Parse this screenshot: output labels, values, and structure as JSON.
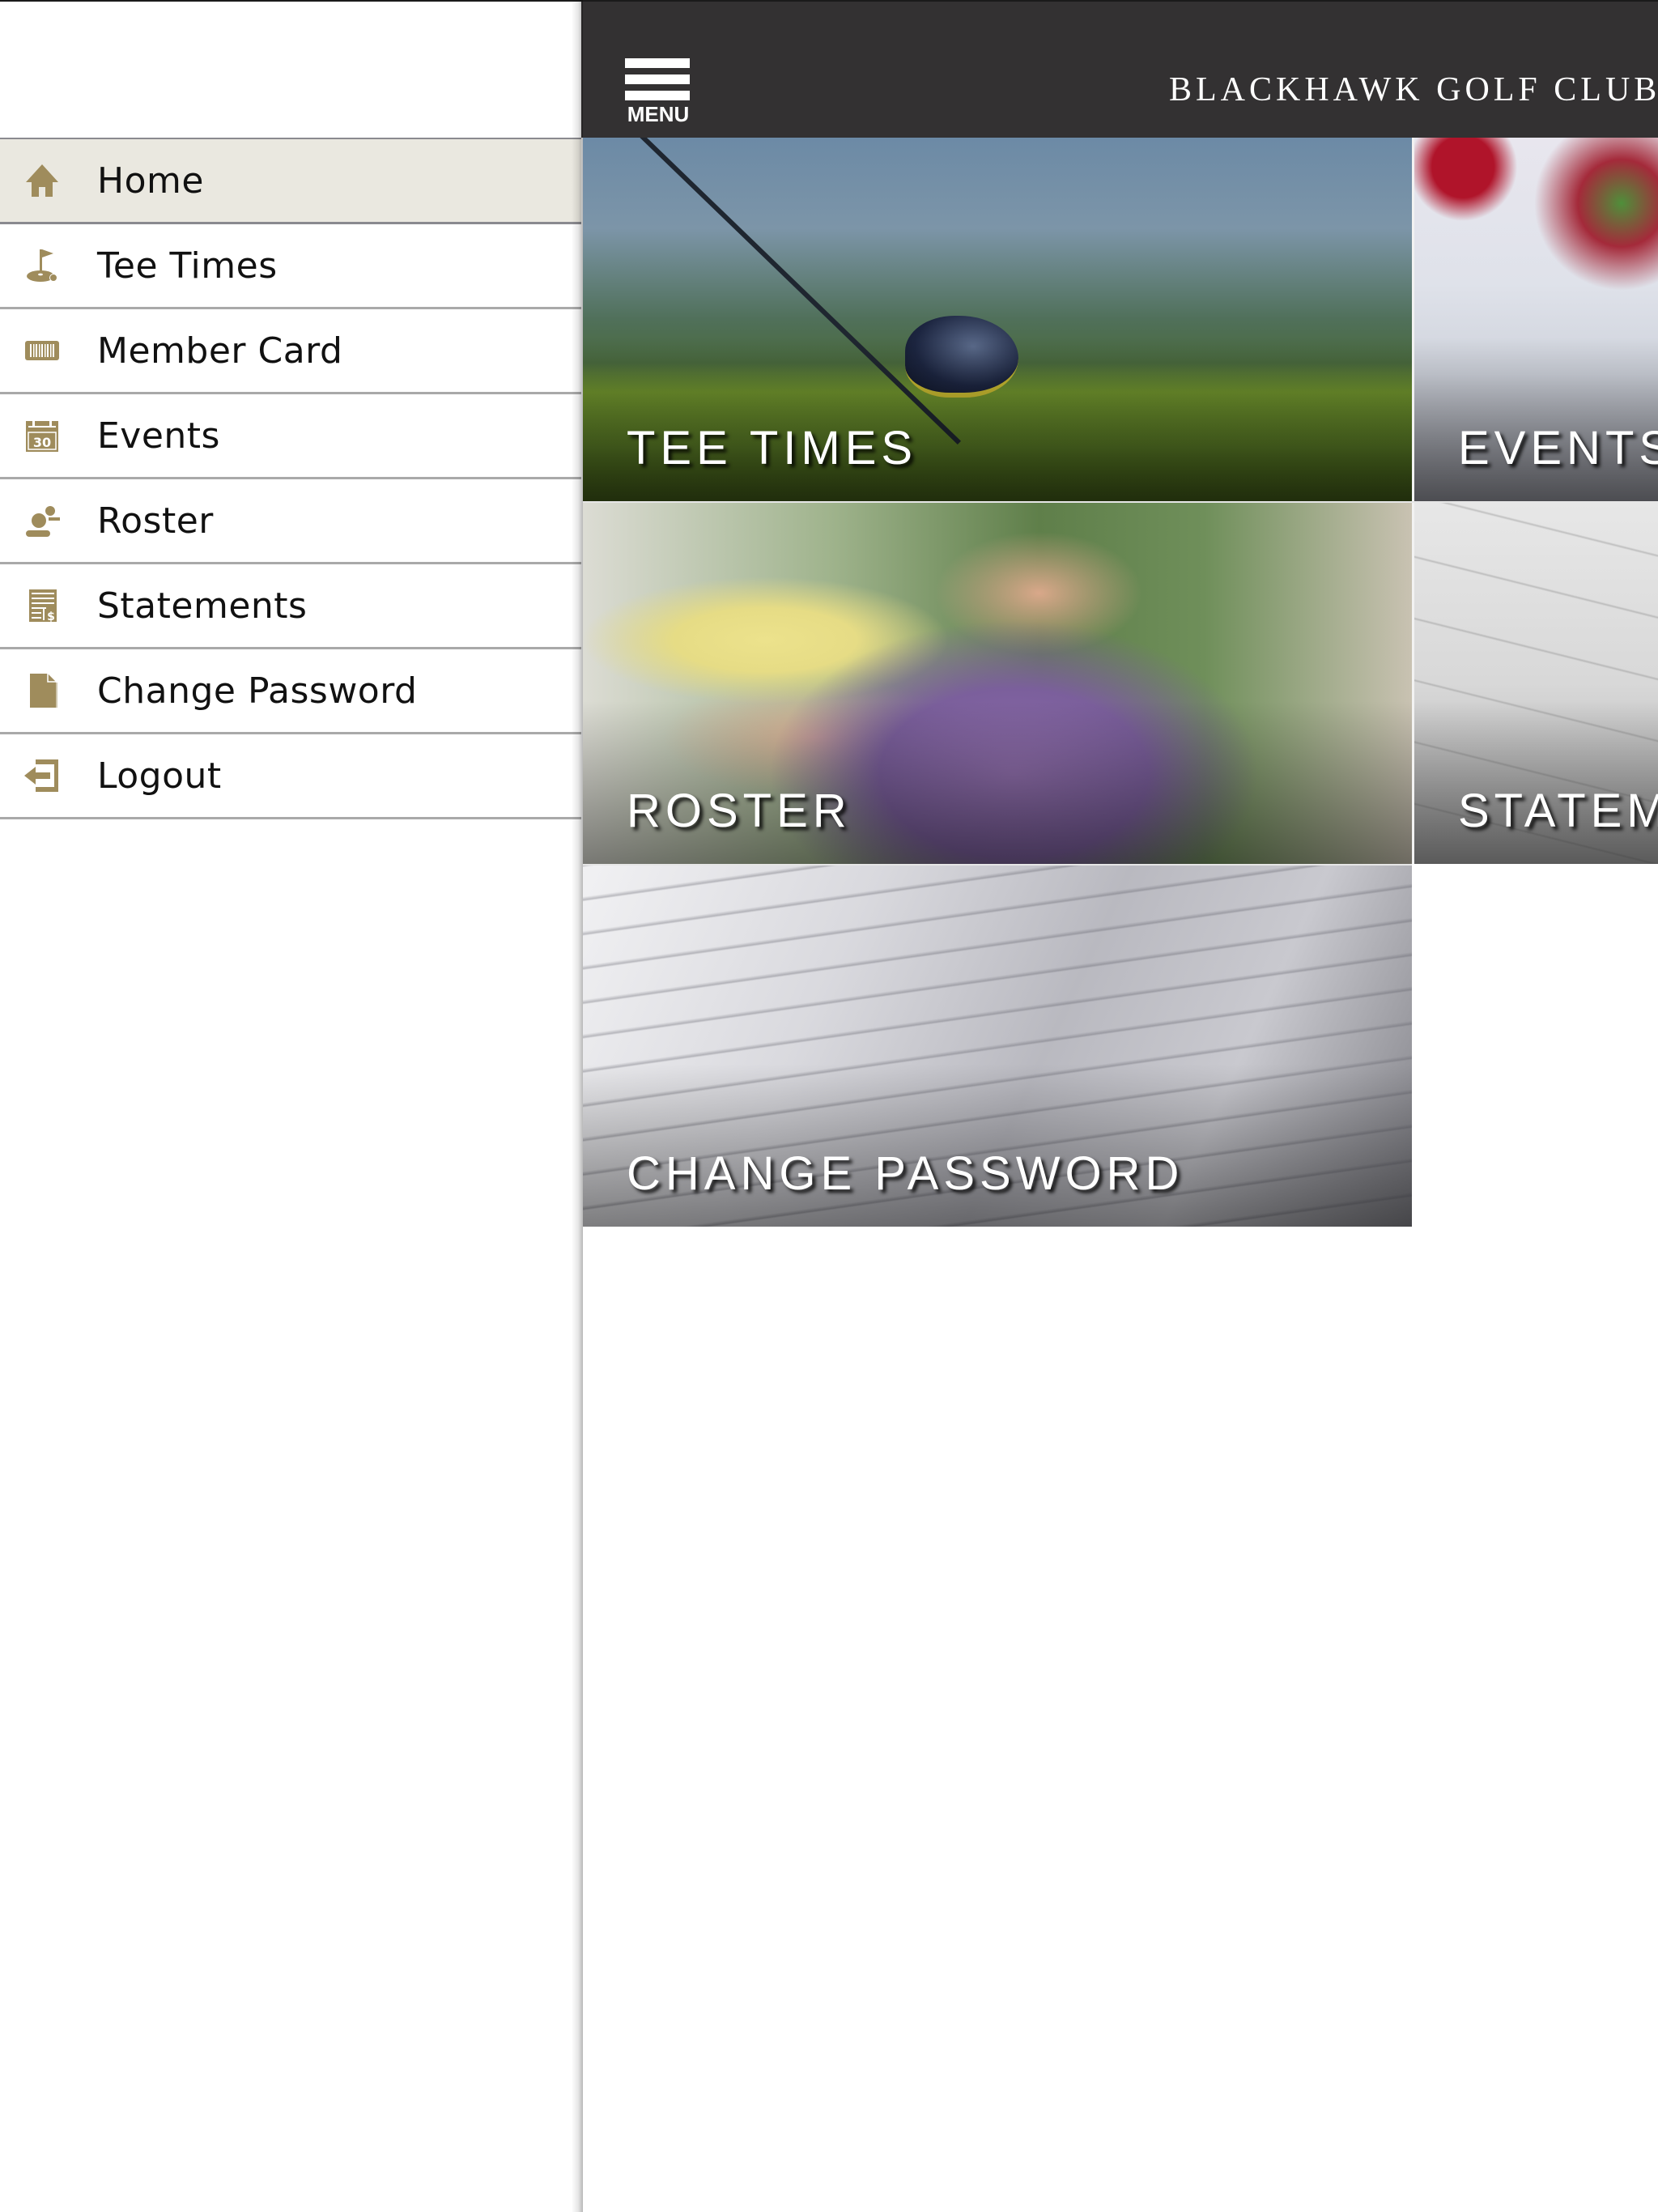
{
  "header": {
    "menu_label": "MENU",
    "club_name": "BLACKHAWK GOLF CLUB"
  },
  "sidebar": {
    "active_item": "Home",
    "items": [
      {
        "label": "Home",
        "icon": "home-icon"
      },
      {
        "label": "Tee Times",
        "icon": "golf-flag-icon"
      },
      {
        "label": "Member Card",
        "icon": "barcode-card-icon"
      },
      {
        "label": "Events",
        "icon": "calendar-icon"
      },
      {
        "label": "Roster",
        "icon": "people-icon"
      },
      {
        "label": "Statements",
        "icon": "statement-icon"
      },
      {
        "label": "Change Password",
        "icon": "document-icon"
      },
      {
        "label": "Logout",
        "icon": "logout-icon"
      }
    ]
  },
  "tiles": [
    {
      "label": "TEE TIMES",
      "image": "golf club and ball on grass"
    },
    {
      "label": "EVENTS",
      "image": "dining table with flowers"
    },
    {
      "label": "ROSTER",
      "image": "group of smiling golfers"
    },
    {
      "label": "STATEM",
      "image": "statement paper"
    },
    {
      "label": "CHANGE PASSWORD",
      "image": "stack of envelopes"
    }
  ],
  "colors": {
    "header_bg": "#333132",
    "icon_gold": "#9f8c5c",
    "active_row_bg": "#eae8e0",
    "divider": "#a9a9a9"
  },
  "calendar_icon_day": "30"
}
